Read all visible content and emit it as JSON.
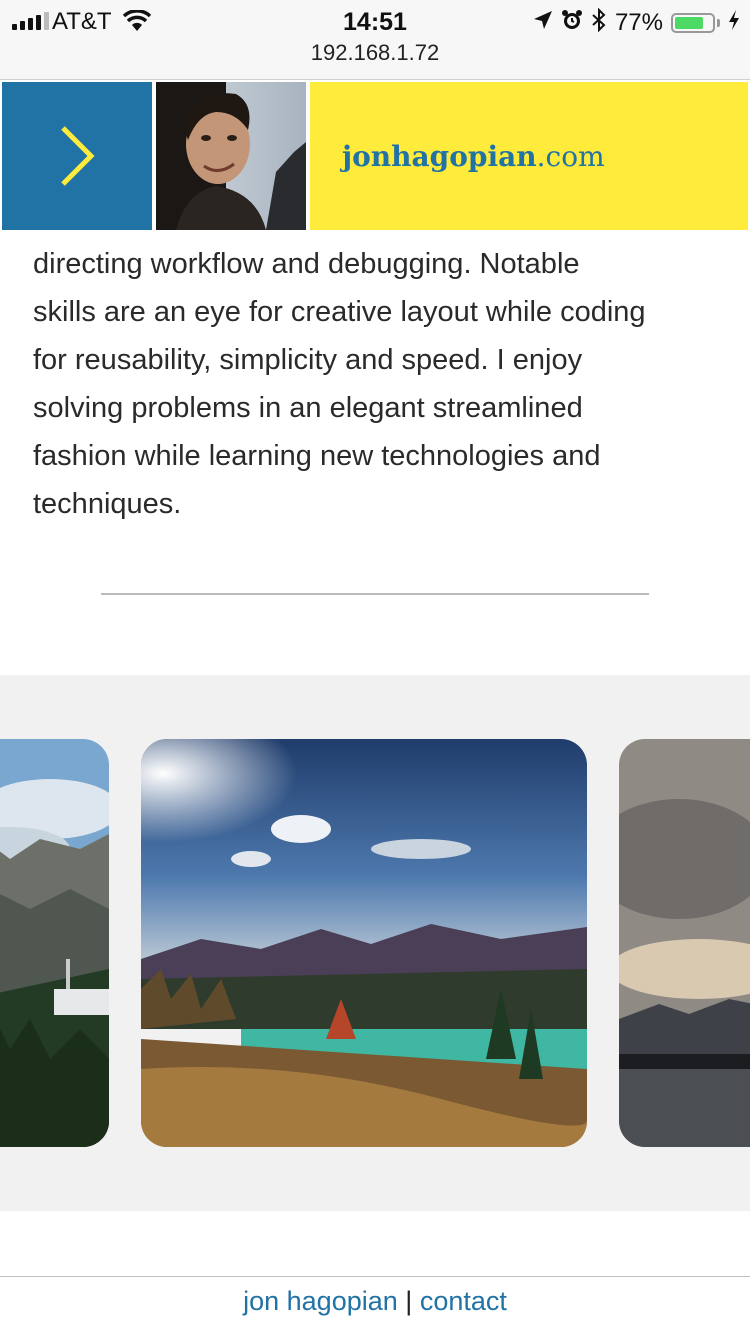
{
  "status_bar": {
    "carrier": "AT&T",
    "time": "14:51",
    "battery": "77%",
    "battery_level": 0.77,
    "url": "192.168.1.72",
    "icons": [
      "signal-icon",
      "wifi-icon",
      "location-icon",
      "alarm-icon",
      "bluetooth-icon",
      "battery-icon",
      "charging-icon"
    ]
  },
  "header": {
    "menu_icon": "chevron-right-icon",
    "brand_main": "jonhagopian",
    "brand_suffix": ".com",
    "colors": {
      "menu_bg": "#2172a5",
      "brand_bg": "#ffeb3b",
      "chevron": "#ffeb3b",
      "brand_text": "#2172a5"
    }
  },
  "bio": {
    "lines": [
      "directing workflow and debugging. Notable",
      "skills are an eye for creative layout while coding",
      "for reusability, simplicity and speed. I enjoy",
      "solving problems in an elegant streamlined",
      "fashion while learning new technologies and",
      "techniques."
    ]
  },
  "gallery": {
    "photos": [
      "mountain-tower-photo",
      "mountain-lake-photo",
      "cloudy-lake-photo"
    ]
  },
  "footer": {
    "name_link": "jon hagopian",
    "separator": "|",
    "contact_link": "contact"
  }
}
